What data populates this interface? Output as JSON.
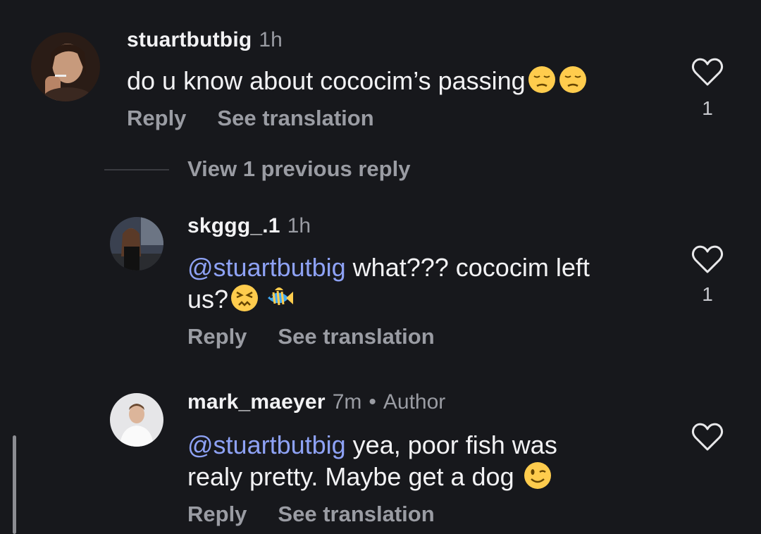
{
  "comments": [
    {
      "username": "stuartbutbig",
      "time": "1h",
      "text": "do u know about cococim’s passing",
      "emojis": [
        "pensive-face",
        "pensive-face"
      ],
      "reply_label": "Reply",
      "translate_label": "See translation",
      "like_count": "1"
    },
    {
      "username": "skggg_.1",
      "time": "1h",
      "mention": "@stuartbutbig",
      "text_line1": " what??? cococim left",
      "text_line2": "us?",
      "emojis": [
        "persevering-face",
        "tropical-fish"
      ],
      "reply_label": "Reply",
      "translate_label": "See translation",
      "like_count": "1"
    },
    {
      "username": "mark_maeyer",
      "time": "7m",
      "separator": "•",
      "author_label": "Author",
      "mention": "@stuartbutbig",
      "text_line1": " yea, poor fish was",
      "text_line2": "realy pretty. Maybe get a dog ",
      "emojis": [
        "winking-face"
      ],
      "reply_label": "Reply",
      "translate_label": "See translation"
    }
  ],
  "view_replies_label": "View 1 previous reply",
  "colors": {
    "background": "#17181c",
    "text": "#f2f2f4",
    "secondary": "#9a9ca3",
    "mention": "#8ea2f5"
  }
}
